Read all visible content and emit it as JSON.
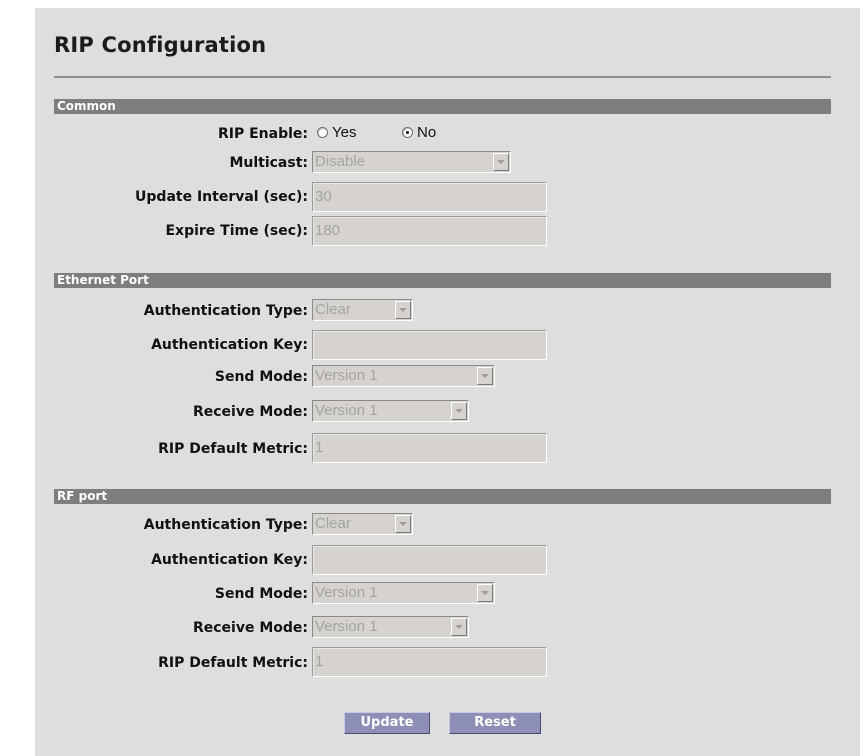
{
  "page": {
    "title": "RIP Configuration"
  },
  "common": {
    "header": "Common",
    "rip_enable": {
      "label": "RIP Enable:",
      "options": [
        "Yes",
        "No"
      ],
      "selected": "No"
    },
    "multicast": {
      "label": "Multicast:",
      "value": "Disable"
    },
    "update_interval": {
      "label": "Update Interval (sec):",
      "value": "30"
    },
    "expire_time": {
      "label": "Expire Time (sec):",
      "value": "180"
    }
  },
  "ethernet": {
    "header": "Ethernet Port",
    "auth_type": {
      "label": "Authentication Type:",
      "value": "Clear"
    },
    "auth_key": {
      "label": "Authentication Key:",
      "value": ""
    },
    "send_mode": {
      "label": "Send Mode:",
      "value": "Version 1"
    },
    "receive_mode": {
      "label": "Receive Mode:",
      "value": "Version 1"
    },
    "default_metric": {
      "label": "RIP Default Metric:",
      "value": "1"
    }
  },
  "rf": {
    "header": "RF port",
    "auth_type": {
      "label": "Authentication Type:",
      "value": "Clear"
    },
    "auth_key": {
      "label": "Authentication Key:",
      "value": ""
    },
    "send_mode": {
      "label": "Send Mode:",
      "value": "Version 1"
    },
    "receive_mode": {
      "label": "Receive Mode:",
      "value": "Version 1"
    },
    "default_metric": {
      "label": "RIP Default Metric:",
      "value": "1"
    }
  },
  "buttons": {
    "update": "Update",
    "reset": "Reset"
  }
}
